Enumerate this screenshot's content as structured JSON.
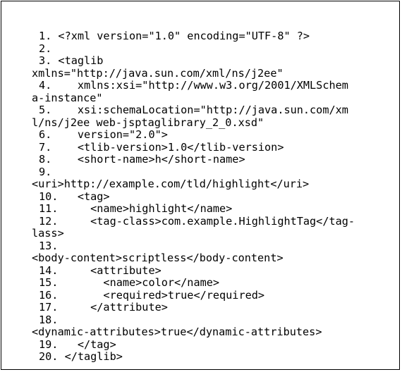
{
  "document": {
    "lines": [
      "1. <?xml version=\"1.0\" encoding=\"UTF-8\" ?>",
      "2.",
      "3. <taglib",
      "xmlns=\"http://java.sun.com/xml/ns/j2ee\"",
      "4.    xmlns:xsi=\"http://www.w3.org/2001/XMLSchem",
      "a-instance\"",
      "5.    xsi:schemaLocation=\"http://java.sun.com/xm",
      "l/ns/j2ee web-jsptaglibrary_2_0.xsd\"",
      "6.    version=\"2.0\">",
      "7.    <tlib-version>1.0</tlib-version>",
      "8.    <short-name>h</short-name>",
      "9.",
      "<uri>http://example.com/tld/highlight</uri>",
      "10.   <tag>",
      "11.     <name>highlight</name>",
      "12.     <tag-class>com.example.HighlightTag</tag-",
      "lass>",
      "13.",
      "<body-content>scriptless</body-content>",
      "14.     <attribute>",
      "15.       <name>color</name>",
      "16.       <required>true</required>",
      "17.     </attribute>",
      "18.",
      "<dynamic-attributes>true</dynamic-attributes>",
      "19.   </tag>",
      "20. </taglib>"
    ]
  }
}
